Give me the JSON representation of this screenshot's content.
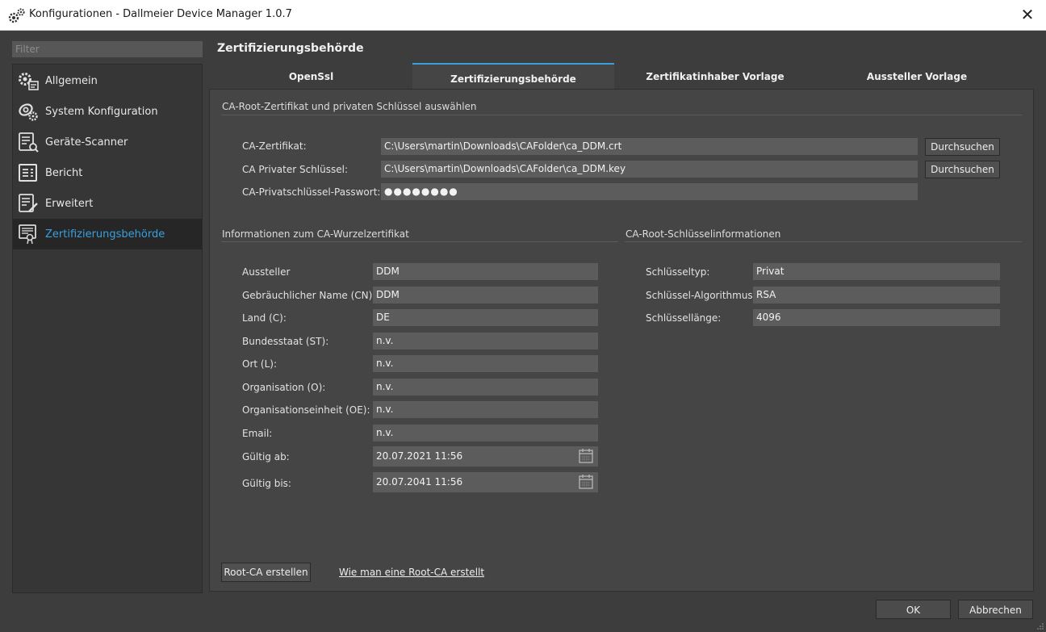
{
  "window": {
    "title": "Konfigurationen - Dallmeier Device Manager 1.0.7"
  },
  "sidebar": {
    "filter_placeholder": "Filter",
    "items": [
      {
        "label": "Allgemein",
        "icon": "gears-icon"
      },
      {
        "label": "System Konfiguration",
        "icon": "camera-gear-icon"
      },
      {
        "label": "Geräte-Scanner",
        "icon": "scanner-list-icon"
      },
      {
        "label": "Bericht",
        "icon": "report-icon"
      },
      {
        "label": "Erweitert",
        "icon": "list-edit-icon"
      },
      {
        "label": "Zertifizierungsbehörde",
        "icon": "certificate-icon",
        "active": true
      }
    ]
  },
  "main": {
    "title": "Zertifizierungsbehörde",
    "tabs": [
      {
        "label": "OpenSsl"
      },
      {
        "label": "Zertifizierungsbehörde",
        "active": true
      },
      {
        "label": "Zertifikatinhaber Vorlage"
      },
      {
        "label": "Aussteller Vorlage"
      }
    ],
    "ca_select": {
      "title": "CA-Root-Zertifikat und privaten Schlüssel auswählen",
      "cert_label": "CA-Zertifikat:",
      "cert_value": "C:\\Users\\martin\\Downloads\\CAFolder\\ca_DDM.crt",
      "key_label": "CA Privater Schlüssel:",
      "key_value": "C:\\Users\\martin\\Downloads\\CAFolder\\ca_DDM.key",
      "password_label": "CA-Privatschlüssel-Passwort:",
      "password_value": "●●●●●●●●",
      "browse_label": "Durchsuchen"
    },
    "root_info": {
      "title": "Informationen zum CA-Wurzelzertifikat",
      "fields": [
        {
          "label": "Aussteller",
          "value": "DDM"
        },
        {
          "label": "Gebräuchlicher Name (CN):",
          "value": "DDM"
        },
        {
          "label": "Land (C):",
          "value": "DE"
        },
        {
          "label": "Bundesstaat (ST):",
          "value": "n.v."
        },
        {
          "label": "Ort (L):",
          "value": "n.v."
        },
        {
          "label": "Organisation (O):",
          "value": "n.v."
        },
        {
          "label": "Organisationseinheit (OE):",
          "value": "n.v."
        },
        {
          "label": "Email:",
          "value": "n.v."
        }
      ],
      "valid_from_label": "Gültig ab:",
      "valid_from_value": "20.07.2021 11:56",
      "valid_to_label": "Gültig bis:",
      "valid_to_value": "20.07.2041 11:56"
    },
    "key_info": {
      "title": "CA-Root-Schlüsselinformationen",
      "fields": [
        {
          "label": "Schlüsseltyp:",
          "value": "Privat"
        },
        {
          "label": "Schlüssel-Algorithmus:",
          "value": "RSA"
        },
        {
          "label": "Schlüssellänge:",
          "value": "4096"
        }
      ]
    },
    "create_button": "Root-CA erstellen",
    "help_link": "Wie man eine Root-CA erstellt"
  },
  "footer": {
    "ok_label": "OK",
    "cancel_label": "Abbrechen"
  },
  "colors": {
    "accent": "#3aa0dc",
    "field_bg": "#5c5c5c",
    "panel_bg": "#454545"
  }
}
